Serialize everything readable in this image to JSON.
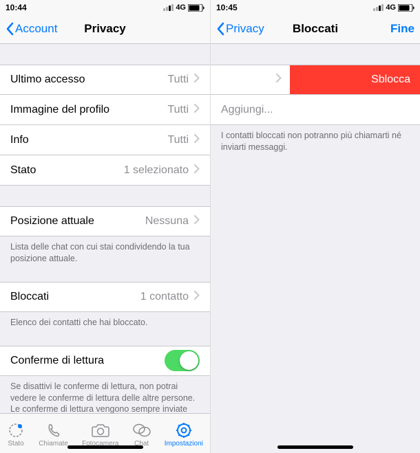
{
  "left": {
    "status": {
      "time": "10:44",
      "network": "4G"
    },
    "nav": {
      "back": "Account",
      "title": "Privacy"
    },
    "rows": {
      "lastAccess": {
        "label": "Ultimo accesso",
        "value": "Tutti"
      },
      "profileImage": {
        "label": "Immagine del profilo",
        "value": "Tutti"
      },
      "info": {
        "label": "Info",
        "value": "Tutti"
      },
      "status": {
        "label": "Stato",
        "value": "1 selezionato"
      },
      "liveLocation": {
        "label": "Posizione attuale",
        "value": "Nessuna"
      },
      "blocked": {
        "label": "Bloccati",
        "value": "1 contatto"
      },
      "readReceipts": {
        "label": "Conferme di lettura"
      }
    },
    "footers": {
      "liveLocation": "Lista delle chat con cui stai condividendo la tua posizione attuale.",
      "blocked": "Elenco dei contatti che hai bloccato.",
      "readReceipts": "Se disattivi le conferme di lettura, non potrai vedere le conferme di lettura delle altre persone. Le conferme di lettura vengono sempre inviate per le chat di gruppo."
    },
    "tabs": {
      "status": "Stato",
      "calls": "Chiamate",
      "camera": "Fotocamera",
      "chat": "Chat",
      "settings": "Impostazioni"
    }
  },
  "right": {
    "status": {
      "time": "10:45",
      "network": "4G"
    },
    "nav": {
      "back": "Privacy",
      "title": "Bloccati",
      "done": "Fine"
    },
    "swipeAction": "Sblocca",
    "addNew": "Aggiungi...",
    "footer": "I contatti bloccati non potranno più chiamarti né inviarti messaggi."
  }
}
